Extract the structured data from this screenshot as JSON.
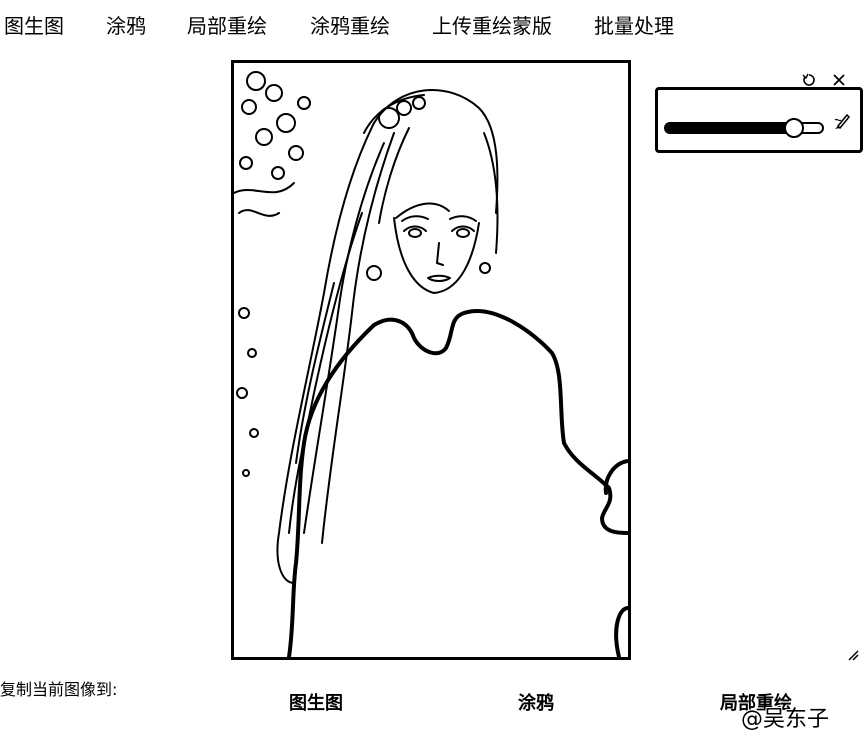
{
  "tabs": [
    "图生图",
    "涂鸦",
    "局部重绘",
    "涂鸦重绘",
    "上传重绘蒙版",
    "批量处理"
  ],
  "brush": {
    "size_fraction": 0.82
  },
  "icons": {
    "reset": "undo-icon",
    "close": "close-icon",
    "brush": "pen-icon",
    "resize": "resize-handle-icon"
  },
  "copy_to": {
    "label": "复制当前图像到:",
    "buttons": [
      "图生图",
      "涂鸦",
      "局部重绘"
    ]
  },
  "watermark": "@吴东子"
}
